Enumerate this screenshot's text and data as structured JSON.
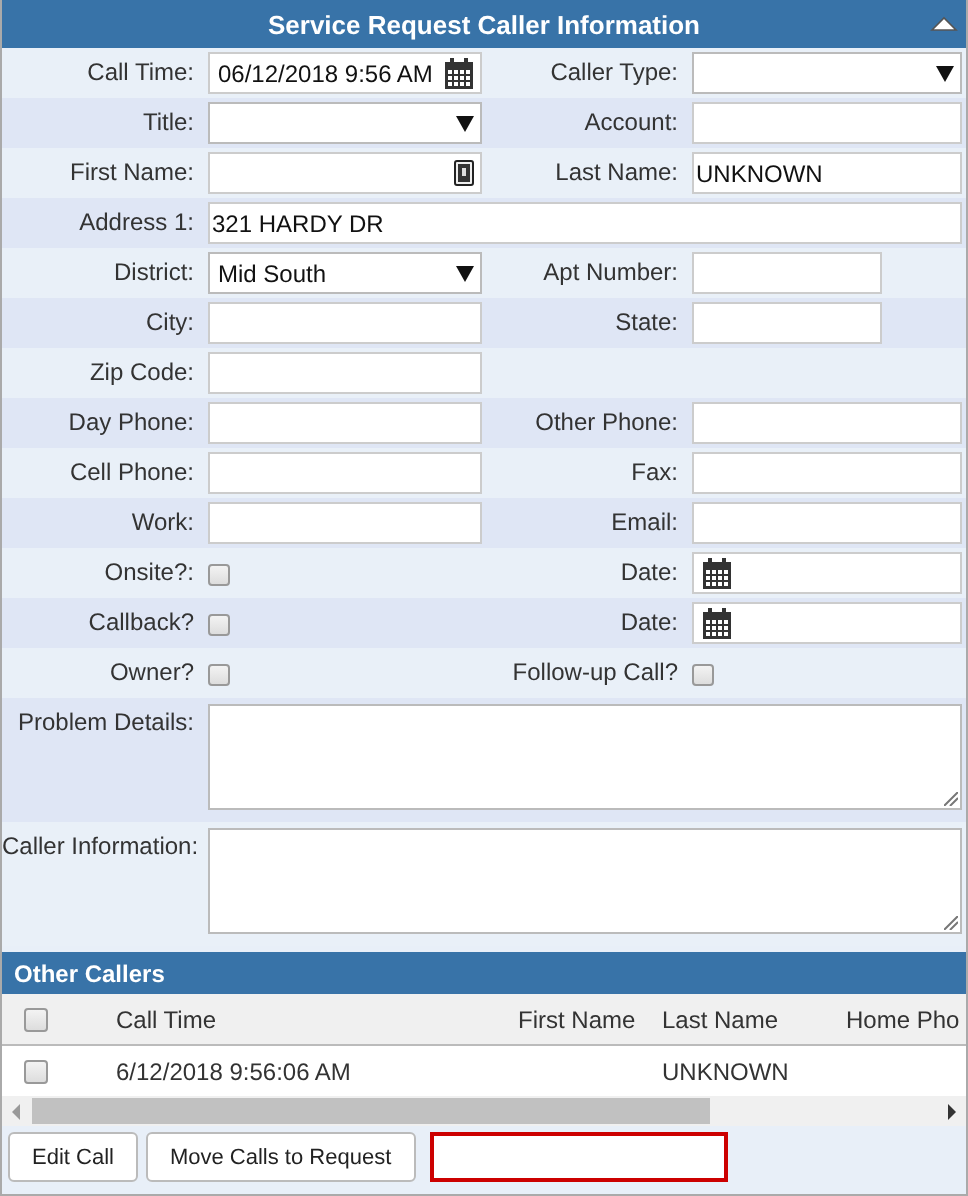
{
  "panel": {
    "title": "Service Request Caller Information",
    "collapsed": false
  },
  "rows": [
    {
      "cells": [
        {
          "label": "Call Time:",
          "kind": "date",
          "value": "06/12/2018 9:56 AM"
        },
        {
          "label": "Caller Type:",
          "kind": "select"
        }
      ]
    },
    {
      "cells": [
        {
          "label": "Title:",
          "kind": "select"
        },
        {
          "label": "Account:",
          "kind": "text"
        }
      ]
    },
    {
      "cells": [
        {
          "label": "First Name:",
          "kind": "contact"
        },
        {
          "label": "Last Name:",
          "kind": "text",
          "value": "UNKNOWN"
        }
      ]
    },
    {
      "cells": [
        {
          "label": "Address 1:",
          "kind": "wide",
          "value": "321 HARDY DR"
        }
      ]
    },
    {
      "cells": [
        {
          "label": "District:",
          "kind": "select",
          "value": "Mid South"
        },
        {
          "label": "Apt Number:",
          "kind": "short"
        }
      ]
    },
    {
      "cells": [
        {
          "label": "City:",
          "kind": "text"
        },
        {
          "label": "State:",
          "kind": "short"
        }
      ]
    },
    {
      "cells": [
        {
          "label": "Zip Code:",
          "kind": "text"
        }
      ]
    },
    {
      "cells": [
        {
          "label": "Day Phone:",
          "kind": "text"
        },
        {
          "label": "Other Phone:",
          "kind": "text"
        }
      ]
    },
    {
      "cells": [
        {
          "label": "Cell Phone:",
          "kind": "text"
        },
        {
          "label": "Fax:",
          "kind": "text"
        }
      ]
    },
    {
      "cells": [
        {
          "label": "Work:",
          "kind": "text"
        },
        {
          "label": "Email:",
          "kind": "text"
        }
      ]
    },
    {
      "cells": [
        {
          "label": "Onsite?:",
          "kind": "checkbox",
          "checked": false
        },
        {
          "label": "Date:",
          "kind": "date"
        }
      ]
    },
    {
      "cells": [
        {
          "label": "Callback?",
          "kind": "checkbox",
          "checked": false
        },
        {
          "label": "Date:",
          "kind": "date"
        }
      ]
    },
    {
      "cells": [
        {
          "label": "Owner?",
          "kind": "checkbox",
          "checked": false
        },
        {
          "label": "Follow-up Call?",
          "kind": "checkbox",
          "checked": false
        }
      ]
    },
    {
      "cells": [
        {
          "label": "Problem Details:",
          "kind": "textarea"
        }
      ]
    },
    {
      "cells": [
        {
          "label": "Caller Information:",
          "kind": "textarea"
        }
      ]
    }
  ],
  "other_callers": {
    "title": "Other Callers",
    "select_all_checked": false,
    "columns": [
      "Call Time",
      "First Name",
      "Last Name",
      "Home Pho"
    ],
    "rows": [
      {
        "checked": false,
        "call_time": "6/12/2018 9:56:06 AM",
        "last_name": "UNKNOWN"
      }
    ]
  },
  "buttons": [
    "Edit Call",
    "Move Calls to Request"
  ],
  "extra_field": {
    "invalid": true
  }
}
